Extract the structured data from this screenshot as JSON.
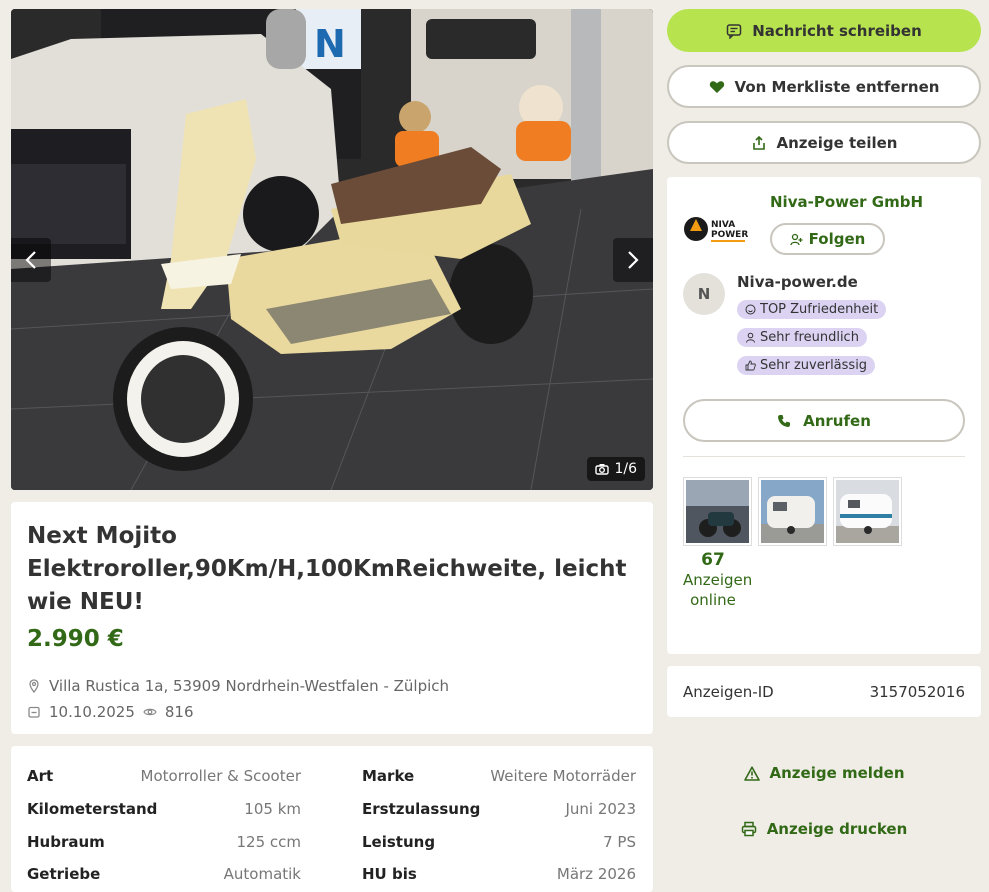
{
  "gallery": {
    "counter": "1/6"
  },
  "listing": {
    "title": "Next Mojito Elektroroller,90Km/H,100KmReichweite, leicht wie NEU!",
    "price": "2.990 €",
    "location": "Villa Rustica 1a, 53909 Nordrhein-Westfalen - Zülpich",
    "date": "10.10.2025",
    "views": "816"
  },
  "details": {
    "left": [
      {
        "label": "Art",
        "value": "Motorroller & Scooter"
      },
      {
        "label": "Kilometerstand",
        "value": "105 km"
      },
      {
        "label": "Hubraum",
        "value": "125 ccm"
      },
      {
        "label": "Getriebe",
        "value": "Automatik"
      }
    ],
    "right": [
      {
        "label": "Marke",
        "value": "Weitere Motorräder"
      },
      {
        "label": "Erstzulassung",
        "value": "Juni 2023"
      },
      {
        "label": "Leistung",
        "value": "7 PS"
      },
      {
        "label": "HU bis",
        "value": "März 2026"
      }
    ]
  },
  "actions": {
    "message": "Nachricht schreiben",
    "unwatch": "Von Merkliste entfernen",
    "share": "Anzeige teilen",
    "report": "Anzeige melden",
    "print": "Anzeige drucken"
  },
  "seller": {
    "name": "Niva-Power GmbH",
    "follow": "Folgen",
    "logo_text_1": "NIVA",
    "logo_text_2": "POWER",
    "avatar_initial": "N",
    "site": "Niva-power.de",
    "badges": [
      "TOP Zufriedenheit",
      "Sehr freundlich",
      "Sehr zuverlässig"
    ],
    "call": "Anrufen",
    "ads_count": "67",
    "ads_label": "Anzeigen online"
  },
  "ad_id": {
    "label": "Anzeigen-ID",
    "value": "3157052016"
  },
  "colors": {
    "accent": "#b7e34e",
    "brand_green": "#326916",
    "badge_bg": "#dcd3f3",
    "page_bg": "#efede6"
  }
}
